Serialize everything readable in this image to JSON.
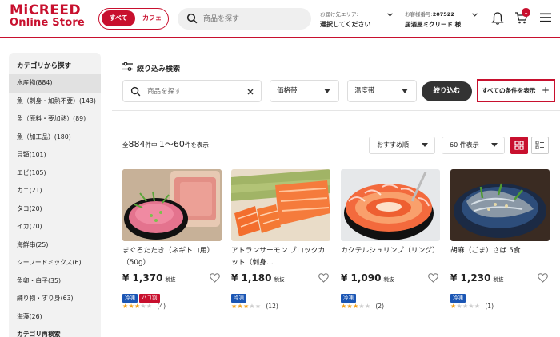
{
  "header": {
    "logo_line1": "MiCREED",
    "logo_line2": "Online Store",
    "toggle_all": "すべて",
    "toggle_cafe": "カフェ",
    "search_placeholder": "商品を探す",
    "delivery_label": "お届け先エリア:",
    "delivery_value": "選択してください",
    "customer_label": "お客様番号:",
    "customer_number": "207522",
    "customer_name": "居酒屋ミクリード 様",
    "cart_count": "1"
  },
  "sidebar": {
    "title": "カテゴリから探す",
    "items": [
      {
        "label": "水産物(884)",
        "active": true
      },
      {
        "label": "魚（刺身・加熱不要）(143)"
      },
      {
        "label": "魚（原料・要加熱）(89)"
      },
      {
        "label": "魚（加工品）(180)"
      },
      {
        "label": "貝類(101)"
      },
      {
        "label": "エビ(105)"
      },
      {
        "label": "カニ(21)"
      },
      {
        "label": "タコ(20)"
      },
      {
        "label": "イカ(70)"
      },
      {
        "label": "海鮮串(25)"
      },
      {
        "label": "シーフードミックス(6)"
      },
      {
        "label": "魚卵・白子(35)"
      },
      {
        "label": "練り物・すり身(63)"
      },
      {
        "label": "海藻(26)"
      },
      {
        "label": "カテゴリ再検索"
      }
    ]
  },
  "filter": {
    "title": "絞り込み検索",
    "search_placeholder": "商品を探す",
    "price_label": "価格帯",
    "temp_label": "温度帯",
    "apply_label": "絞り込む",
    "all_conditions_label": "すべての条件を表示"
  },
  "results": {
    "prefix": "全",
    "total": "884",
    "middle": "件中 ",
    "range": "1〜60",
    "suffix": "件を表示",
    "sort_label": "おすすめ順",
    "per_page_label": "60 件表示"
  },
  "colors": {
    "brand": "#c8102e",
    "tag_blue": "#1b56b4",
    "star": "#f3a21a"
  },
  "products": [
    {
      "name": "まぐろたたき（ネギトロ用）（50g）",
      "price": "¥ 1,370",
      "tax": "税抜",
      "tags": [
        {
          "text": "冷凍",
          "color": "blue"
        },
        {
          "text": "ハコ割",
          "color": "red"
        }
      ],
      "rating": 3,
      "reviews": "(4)",
      "image": "tuna-negitoro"
    },
    {
      "name": "アトランサーモン ブロックカット（刺身…",
      "price": "¥ 1,180",
      "tax": "税抜",
      "tags": [
        {
          "text": "冷凍",
          "color": "blue"
        }
      ],
      "rating": 3,
      "reviews": "(12)",
      "image": "salmon-block"
    },
    {
      "name": "カクテルシュリンプ（リング）",
      "price": "¥ 1,090",
      "tax": "税抜",
      "tags": [
        {
          "text": "冷凍",
          "color": "blue"
        }
      ],
      "rating": 3,
      "reviews": "(2)",
      "image": "shrimp-ring"
    },
    {
      "name": "胡麻（ごま）さば 5食",
      "price": "¥ 1,230",
      "tax": "税抜",
      "tags": [
        {
          "text": "冷凍",
          "color": "blue"
        }
      ],
      "rating": 1,
      "reviews": "(1)",
      "image": "sesame-mackerel"
    }
  ]
}
